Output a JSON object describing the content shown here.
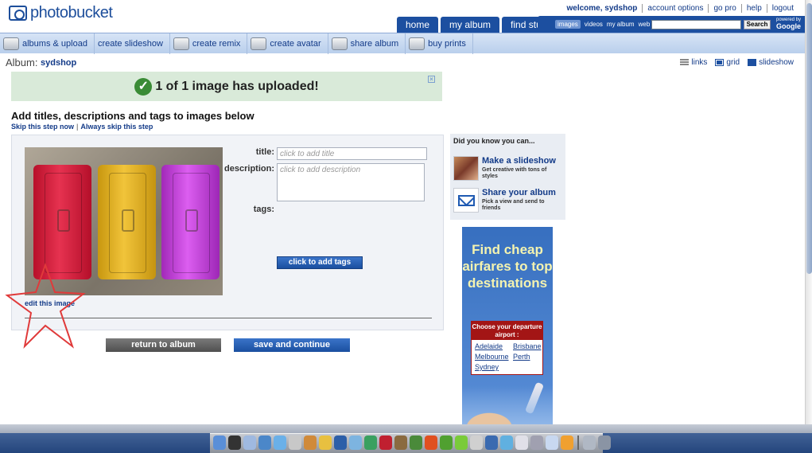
{
  "logo": {
    "text": "photobucket"
  },
  "top_links": [
    "welcome, sydshop",
    "account options",
    "go pro",
    "help",
    "logout"
  ],
  "nav_tabs": [
    "home",
    "my album",
    "find stuff"
  ],
  "search": {
    "types": [
      "images",
      "videos",
      "my album",
      "web"
    ],
    "button": "Search",
    "powered_small": "powered by",
    "powered_brand": "Google"
  },
  "toolbar": [
    "albums & upload",
    "create slideshow",
    "create remix",
    "create avatar",
    "share album",
    "buy prints"
  ],
  "album": {
    "label": "Album:",
    "name": "sydshop"
  },
  "view_options": [
    "links",
    "grid",
    "slideshow"
  ],
  "banner": {
    "check": "✓",
    "text": "1 of 1 image has uploaded!",
    "close": "×"
  },
  "heading": "Add titles, descriptions and tags to images below",
  "skip": {
    "now": "Skip this step now",
    "sep": "|",
    "always": "Always skip this step"
  },
  "form": {
    "title_label": "title:",
    "title_placeholder": "click to add title",
    "description_label": "description:",
    "description_placeholder": "click to add description",
    "tags_label": "tags:",
    "add_tags": "click to add tags",
    "edit_image": "edit this image"
  },
  "buttons": {
    "return": "return to album",
    "save": "save and continue"
  },
  "did_you_know": {
    "title": "Did you know you can...",
    "items": [
      {
        "head": "Make a slideshow",
        "sub": "Get creative with tons of styles"
      },
      {
        "head": "Share your album",
        "sub": "Pick a view and send to friends"
      }
    ]
  },
  "ad": {
    "headline": "Find cheap airfares to top destinations",
    "box_title": "Choose your departure airport :",
    "cities": [
      "Adelaide",
      "Brisbane",
      "Melbourne",
      "Perth",
      "Sydney"
    ]
  },
  "colors": {
    "brand_blue": "#1c4fa0",
    "success_green": "#3a8b36",
    "banner_bg": "#d9ead9",
    "star_red": "#e03a3a"
  }
}
